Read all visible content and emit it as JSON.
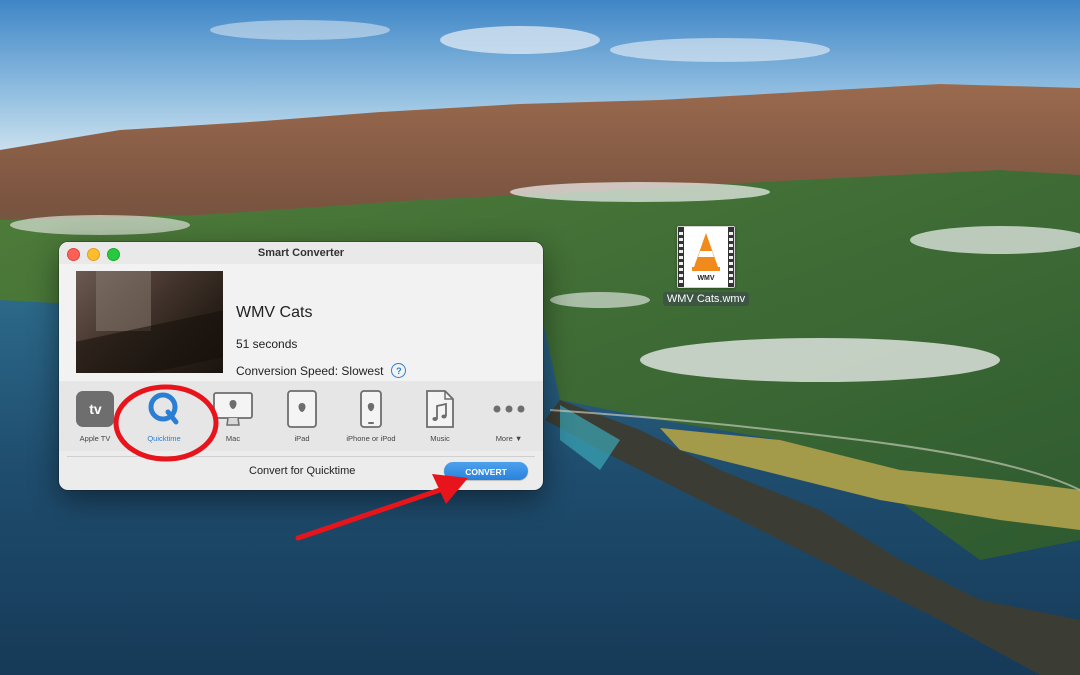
{
  "window": {
    "title": "Smart Converter"
  },
  "video": {
    "title": "WMV Cats",
    "duration": "51 seconds",
    "speed_label": "Conversion Speed: Slowest"
  },
  "devices": [
    {
      "label": "Apple TV",
      "icon": "appletv-icon",
      "selected": false
    },
    {
      "label": "Quicktime",
      "icon": "quicktime-icon",
      "selected": true
    },
    {
      "label": "Mac",
      "icon": "monitor-icon",
      "selected": false
    },
    {
      "label": "iPad",
      "icon": "tablet-icon",
      "selected": false
    },
    {
      "label": "iPhone or iPod",
      "icon": "phone-icon",
      "selected": false
    },
    {
      "label": "Music",
      "icon": "music-file-icon",
      "selected": false
    },
    {
      "label": "More ▼",
      "icon": "more-dots-icon",
      "selected": false
    }
  ],
  "footer": {
    "convert_label": "Convert for Quicktime",
    "convert_button": "CONVERT"
  },
  "desktop": {
    "file_name": "WMV Cats.wmv",
    "file_badge": "WMV"
  },
  "colors": {
    "accent": "#2a7fd4",
    "annotation": "#e8141c",
    "close": "#fe5f57",
    "minimize": "#febc2e",
    "maximize": "#28c840"
  }
}
